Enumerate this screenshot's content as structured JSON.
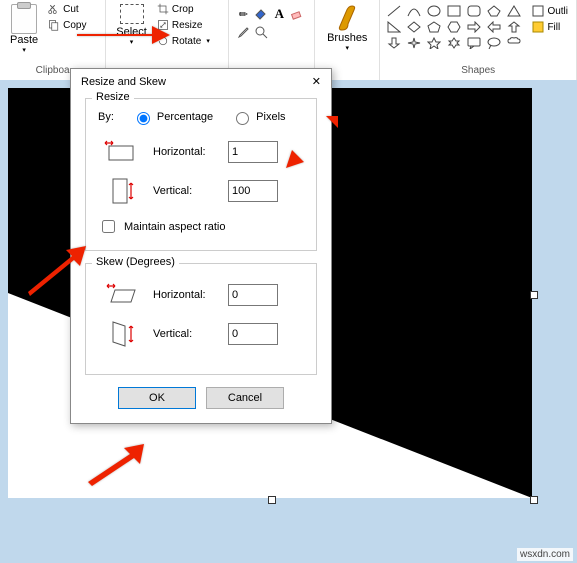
{
  "ribbon": {
    "clipboard": {
      "paste": "Paste",
      "cut": "Cut",
      "copy": "Copy",
      "title": "Clipboa"
    },
    "image": {
      "select": "Select",
      "crop": "Crop",
      "resize": "Resize",
      "rotate": "Rotate"
    },
    "tools": {
      "title": " "
    },
    "brushes": {
      "label": "Brushes"
    },
    "shapes": {
      "title": "Shapes",
      "outline": "Outli",
      "fill": "Fill"
    }
  },
  "dialog": {
    "title": "Resize and Skew",
    "resize": {
      "legend": "Resize",
      "by": "By:",
      "percentage": "Percentage",
      "pixels": "Pixels",
      "horizontal_label": "Horizontal:",
      "horizontal_value": "1",
      "vertical_label": "Vertical:",
      "vertical_value": "100",
      "maintain": "Maintain aspect ratio"
    },
    "skew": {
      "legend": "Skew (Degrees)",
      "horizontal_label": "Horizontal:",
      "horizontal_value": "0",
      "vertical_label": "Vertical:",
      "vertical_value": "0"
    },
    "ok": "OK",
    "cancel": "Cancel"
  },
  "watermark": "wsxdn.com"
}
